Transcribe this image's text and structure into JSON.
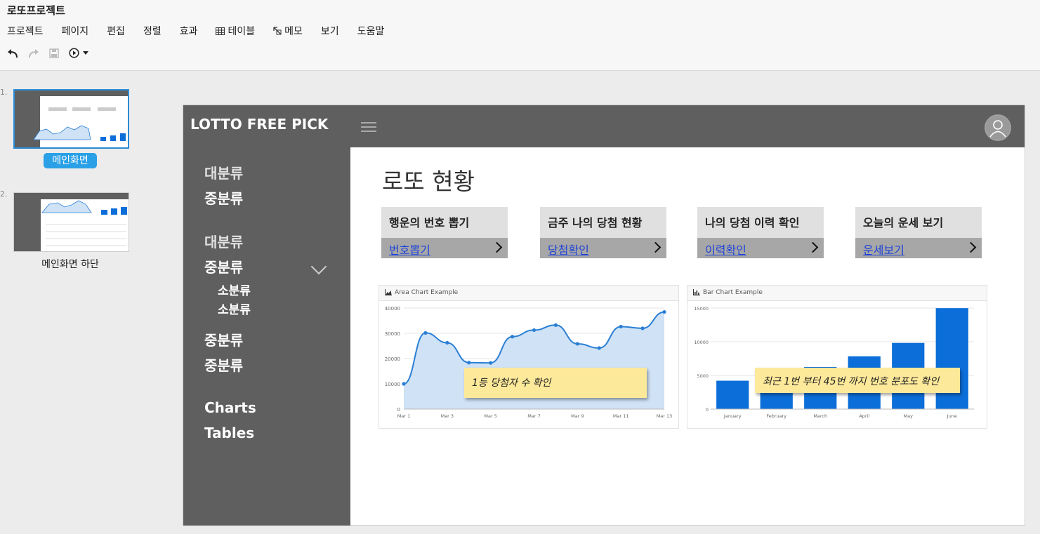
{
  "app": {
    "title": "로또프로젝트",
    "menu": [
      "프로젝트",
      "페이지",
      "편집",
      "정렬",
      "효과",
      "테이블",
      "메모",
      "보기",
      "도움말"
    ]
  },
  "pages": [
    {
      "number": "1.",
      "label": "메인화면",
      "selected": true
    },
    {
      "number": "2.",
      "label": "메인화면 하단",
      "selected": false
    }
  ],
  "site": {
    "brand": "LOTTO FREE PICK",
    "sidebar": {
      "group1": [
        "대분류",
        "중분류"
      ],
      "group2_major": "대분류",
      "group2_mid": "중분류",
      "group2_minor": [
        "소분류",
        "소분류"
      ],
      "group2_mid_extra": [
        "중분류",
        "중분류"
      ],
      "links": [
        "Charts",
        "Tables"
      ]
    },
    "main_title": "로또 현황",
    "cards": [
      {
        "title": "행운의 번호 뽑기",
        "link": "번호뽑기"
      },
      {
        "title": "금주 나의 당첨 현황",
        "link": "당첨확인"
      },
      {
        "title": "나의 당첨 이력 확인",
        "link": "이력확인"
      },
      {
        "title": "오늘의 운세 보기",
        "link": "운세보기"
      }
    ],
    "notes": {
      "area": "1등 당첨자 수 확인",
      "bar": "최근 1번 부터 45번 까지  번호 분포도 확인"
    }
  },
  "chart_data": [
    {
      "type": "area",
      "title": "Area Chart Example",
      "x": [
        "Mar 1",
        "Mar 2",
        "Mar 3",
        "Mar 4",
        "Mar 5",
        "Mar 6",
        "Mar 7",
        "Mar 8",
        "Mar 9",
        "Mar 10",
        "Mar 11",
        "Mar 12",
        "Mar 13"
      ],
      "x_tick_labels": [
        "Mar 1",
        "Mar 3",
        "Mar 5",
        "Mar 7",
        "Mar 9",
        "Mar 11",
        "Mar 13"
      ],
      "values": [
        10000,
        30162,
        26263,
        18394,
        18287,
        28682,
        31274,
        33259,
        25849,
        24159,
        32651,
        31984,
        38451
      ],
      "ylim": [
        0,
        40000
      ],
      "y_ticks": [
        0,
        10000,
        20000,
        30000,
        40000
      ],
      "grid": true,
      "color": "#2a7fd4",
      "fill": "#cfe2f6"
    },
    {
      "type": "bar",
      "title": "Bar Chart Example",
      "categories": [
        "January",
        "February",
        "March",
        "April",
        "May",
        "June"
      ],
      "values": [
        4215,
        5312,
        6251,
        7841,
        9821,
        14984
      ],
      "ylim": [
        0,
        15000
      ],
      "y_ticks": [
        0,
        5000,
        10000,
        15000
      ],
      "grid": true,
      "color": "#0c6fd9"
    }
  ]
}
